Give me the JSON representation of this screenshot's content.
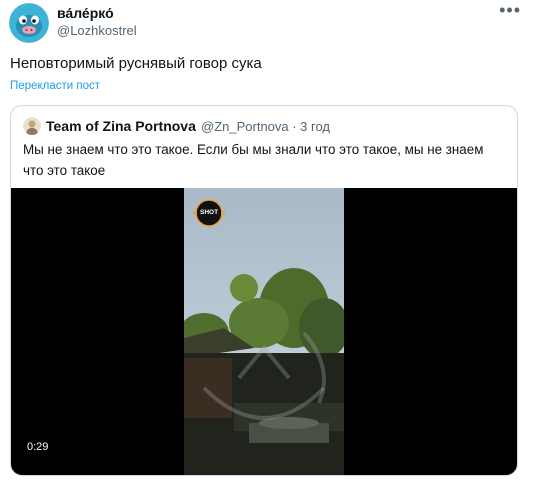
{
  "tweet": {
    "display_name": "ва́ле́рко́",
    "handle": "@Lozhkostrel",
    "more_icon": "more-dots-icon",
    "text": "Неповторимый руснявый говор сука",
    "translate_label": "Перекласти пост"
  },
  "quote": {
    "display_name": "Team of Zina Portnova",
    "handle_time": "@Zn_Portnova · 3 год",
    "text": "Мы не знаем что это такое. Если бы мы знали что это такое, мы не знаем что это такое",
    "video": {
      "watermark": "SHOT",
      "duration": "0:29"
    }
  },
  "colors": {
    "link": "#1d9bf0",
    "secondary_text": "#536471",
    "border": "#cfd9de"
  }
}
